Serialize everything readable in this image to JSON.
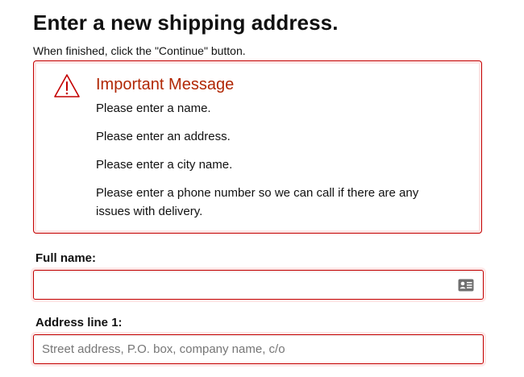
{
  "header": {
    "title": "Enter a new shipping address.",
    "subtitle": "When finished, click the \"Continue\" button."
  },
  "alert": {
    "icon": "warning-triangle-icon",
    "title": "Important Message",
    "messages": [
      "Please enter a name.",
      "Please enter an address.",
      "Please enter a city name.",
      "Please enter a phone number so we can call if there are any issues with delivery."
    ],
    "colors": {
      "border": "#c40000",
      "title": "#b12704"
    }
  },
  "form": {
    "full_name": {
      "label": "Full name:",
      "value": "",
      "placeholder": "",
      "icon": "contact-card-icon"
    },
    "address_line_1": {
      "label": "Address line 1:",
      "value": "",
      "placeholder": "Street address, P.O. box, company name, c/o"
    }
  }
}
